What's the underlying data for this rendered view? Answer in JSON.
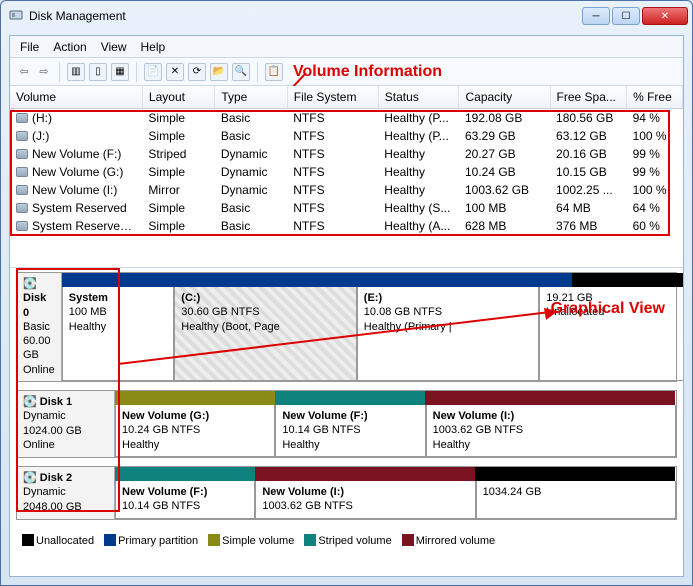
{
  "window": {
    "title": "Disk Management",
    "minimize": "─",
    "maximize": "☐",
    "close": "✕"
  },
  "menu": {
    "file": "File",
    "action": "Action",
    "view": "View",
    "help": "Help"
  },
  "annotations": {
    "volume_info": "Volume Information",
    "graphical_view": "Graphical View"
  },
  "columns": {
    "volume": "Volume",
    "layout": "Layout",
    "type": "Type",
    "fs": "File System",
    "status": "Status",
    "capacity": "Capacity",
    "free": "Free Spa...",
    "pfree": "% Free"
  },
  "rows": [
    {
      "volume": "(H:)",
      "layout": "Simple",
      "type": "Basic",
      "fs": "NTFS",
      "status": "Healthy (P...",
      "capacity": "192.08 GB",
      "free": "180.56 GB",
      "pfree": "94 %"
    },
    {
      "volume": "(J:)",
      "layout": "Simple",
      "type": "Basic",
      "fs": "NTFS",
      "status": "Healthy (P...",
      "capacity": "63.29 GB",
      "free": "63.12 GB",
      "pfree": "100 %"
    },
    {
      "volume": "New Volume (F:)",
      "layout": "Striped",
      "type": "Dynamic",
      "fs": "NTFS",
      "status": "Healthy",
      "capacity": "20.27 GB",
      "free": "20.16 GB",
      "pfree": "99 %"
    },
    {
      "volume": "New Volume (G:)",
      "layout": "Simple",
      "type": "Dynamic",
      "fs": "NTFS",
      "status": "Healthy",
      "capacity": "10.24 GB",
      "free": "10.15 GB",
      "pfree": "99 %"
    },
    {
      "volume": "New Volume (I:)",
      "layout": "Mirror",
      "type": "Dynamic",
      "fs": "NTFS",
      "status": "Healthy",
      "capacity": "1003.62 GB",
      "free": "1002.25 ...",
      "pfree": "100 %"
    },
    {
      "volume": "System Reserved",
      "layout": "Simple",
      "type": "Basic",
      "fs": "NTFS",
      "status": "Healthy (S...",
      "capacity": "100 MB",
      "free": "64 MB",
      "pfree": "64 %"
    },
    {
      "volume": "System Reserved (...",
      "layout": "Simple",
      "type": "Basic",
      "fs": "NTFS",
      "status": "Healthy (A...",
      "capacity": "628 MB",
      "free": "376 MB",
      "pfree": "60 %"
    }
  ],
  "disks": [
    {
      "name": "Disk 0",
      "type": "Basic",
      "size": "60.00 GB",
      "state": "Online",
      "bars": [
        {
          "class": "b-blue",
          "w": "120"
        },
        {
          "class": "b-blue",
          "w": "230"
        },
        {
          "class": "b-blue",
          "w": "160"
        },
        {
          "class": "b-black",
          "w": "150"
        }
      ],
      "parts": [
        {
          "title": "System",
          "line2": "100 MB",
          "line3": "Healthy",
          "w": "50",
          "class": ""
        },
        {
          "title": "(C:)",
          "line2": "30.60 GB NTFS",
          "line3": "Healthy (Boot, Page",
          "w": "120",
          "class": "hatched"
        },
        {
          "title": "(E:)",
          "line2": "10.08 GB NTFS",
          "line3": "Healthy (Primary |",
          "w": "120",
          "class": ""
        },
        {
          "title": "",
          "line2": "19.21 GB",
          "line3": "Unallocated",
          "w": "120",
          "class": ""
        }
      ]
    },
    {
      "name": "Disk 1",
      "type": "Dynamic",
      "size": "1024.00 GB",
      "state": "Online",
      "bars": [
        {
          "class": "b-olive",
          "w": "160"
        },
        {
          "class": "b-teal",
          "w": "150"
        },
        {
          "class": "b-maroon",
          "w": "250"
        }
      ],
      "parts": [
        {
          "title": "New Volume  (G:)",
          "line2": "10.24 GB NTFS",
          "line3": "Healthy",
          "w": "160",
          "class": ""
        },
        {
          "title": "New Volume  (F:)",
          "line2": "10.14 GB NTFS",
          "line3": "Healthy",
          "w": "150",
          "class": ""
        },
        {
          "title": "New Volume  (I:)",
          "line2": "1003.62 GB NTFS",
          "line3": "Healthy",
          "w": "250",
          "class": ""
        }
      ]
    },
    {
      "name": "Disk 2",
      "type": "Dynamic",
      "size": "2048.00 GB",
      "state": "",
      "bars": [
        {
          "class": "b-teal",
          "w": "140"
        },
        {
          "class": "b-maroon",
          "w": "220"
        },
        {
          "class": "b-black",
          "w": "200"
        }
      ],
      "parts": [
        {
          "title": "New Volume  (F:)",
          "line2": "10.14 GB NTFS",
          "line3": "",
          "w": "140",
          "class": ""
        },
        {
          "title": "New Volume  (I:)",
          "line2": "1003.62 GB NTFS",
          "line3": "",
          "w": "220",
          "class": ""
        },
        {
          "title": "",
          "line2": "1034.24 GB",
          "line3": "",
          "w": "200",
          "class": ""
        }
      ]
    }
  ],
  "legend": {
    "unallocated": "Unallocated",
    "primary": "Primary partition",
    "simple": "Simple volume",
    "striped": "Striped volume",
    "mirrored": "Mirrored volume"
  }
}
